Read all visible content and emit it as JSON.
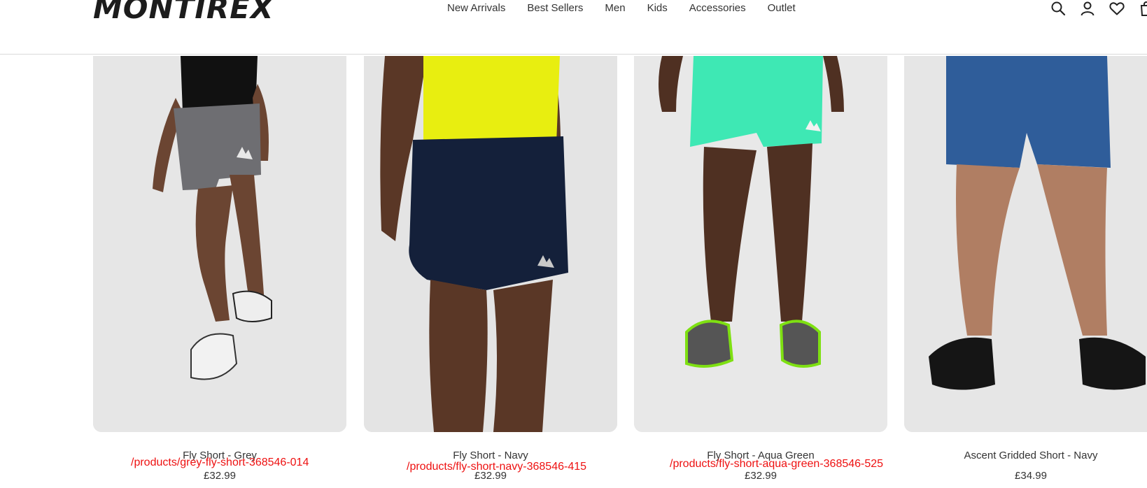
{
  "brand": {
    "logo_text": "MONTIREX"
  },
  "nav": {
    "items": [
      {
        "label": "New Arrivals"
      },
      {
        "label": "Best Sellers"
      },
      {
        "label": "Men"
      },
      {
        "label": "Kids"
      },
      {
        "label": "Accessories"
      },
      {
        "label": "Outlet"
      }
    ]
  },
  "header_icons": [
    "search-icon",
    "account-icon",
    "wishlist-heart-icon",
    "bag-icon"
  ],
  "products": [
    {
      "name": "Fly Short - Grey",
      "price": "£32.99",
      "url": "/products/grey-fly-short-368546-014",
      "short_color": "#6e6e72",
      "top_color": "#111111"
    },
    {
      "name": "Fly Short - Navy",
      "price": "£32.99",
      "url": "/products/fly-short-navy-368546-415",
      "short_color": "#14203a",
      "top_color": "#e8ee10"
    },
    {
      "name": "Fly Short - Aqua Green",
      "price": "£32.99",
      "url": "/products/fly-short-aqua-green-368546-525",
      "short_color": "#3ee8b4",
      "top_color": ""
    },
    {
      "name": "Ascent Gridded Short - Navy",
      "price": "£34.99",
      "url": "",
      "short_color": "#2f5d9a",
      "top_color": ""
    }
  ],
  "colors": {
    "url_text": "#ee1111",
    "card_bg": "#e9e9e9",
    "skin": "#6b4532"
  }
}
